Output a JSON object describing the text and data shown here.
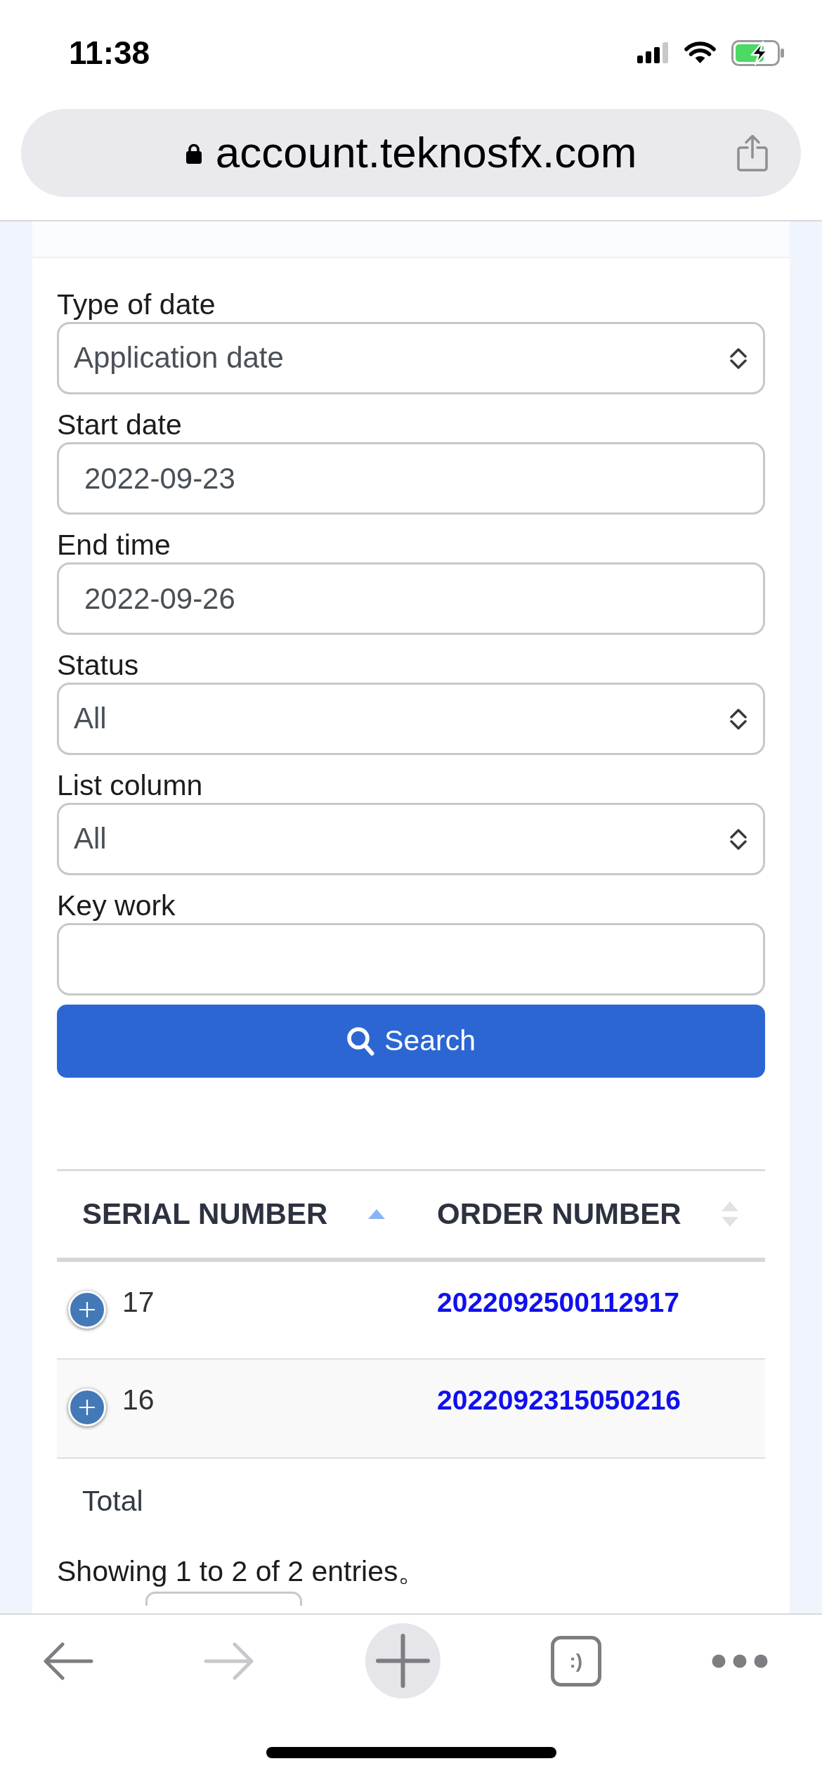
{
  "status_bar": {
    "time": "11:38"
  },
  "address_bar": {
    "url": "account.teknosfx.com",
    "secure": true
  },
  "filter_form": {
    "fields": [
      {
        "kind": "select",
        "label": "Type of date",
        "value": "Application date"
      },
      {
        "kind": "date",
        "label": "Start date",
        "value": "2022-09-23"
      },
      {
        "kind": "date",
        "label": "End time",
        "value": "2022-09-26"
      },
      {
        "kind": "select",
        "label": "Status",
        "value": "All"
      },
      {
        "kind": "select",
        "label": "List column",
        "value": "All"
      },
      {
        "kind": "text",
        "label": "Key work"
      }
    ],
    "search_button": {
      "label": "Search"
    }
  },
  "table": {
    "columns": [
      {
        "label": "SERIAL NUMBER",
        "sorted": true
      },
      {
        "label": "ORDER NUMBER",
        "sorted": false
      }
    ],
    "rows": [
      {
        "serial_number": "17",
        "order_number": "2022092500112917",
        "expanded": false
      },
      {
        "serial_number": "16",
        "order_number": "2022092315050216",
        "expanded": false
      }
    ],
    "footer": {
      "label": "Total"
    }
  },
  "table_info": "Showing 1 to 2 of 2 entries。",
  "toolbar": {
    "buttons": [
      {
        "kind": "back",
        "disabled": false
      },
      {
        "kind": "forward",
        "disabled": true
      },
      {
        "kind": "new_tab",
        "disabled": false
      },
      {
        "kind": "tabs",
        "label": ":)",
        "disabled": false
      },
      {
        "kind": "more",
        "disabled": false
      }
    ]
  }
}
